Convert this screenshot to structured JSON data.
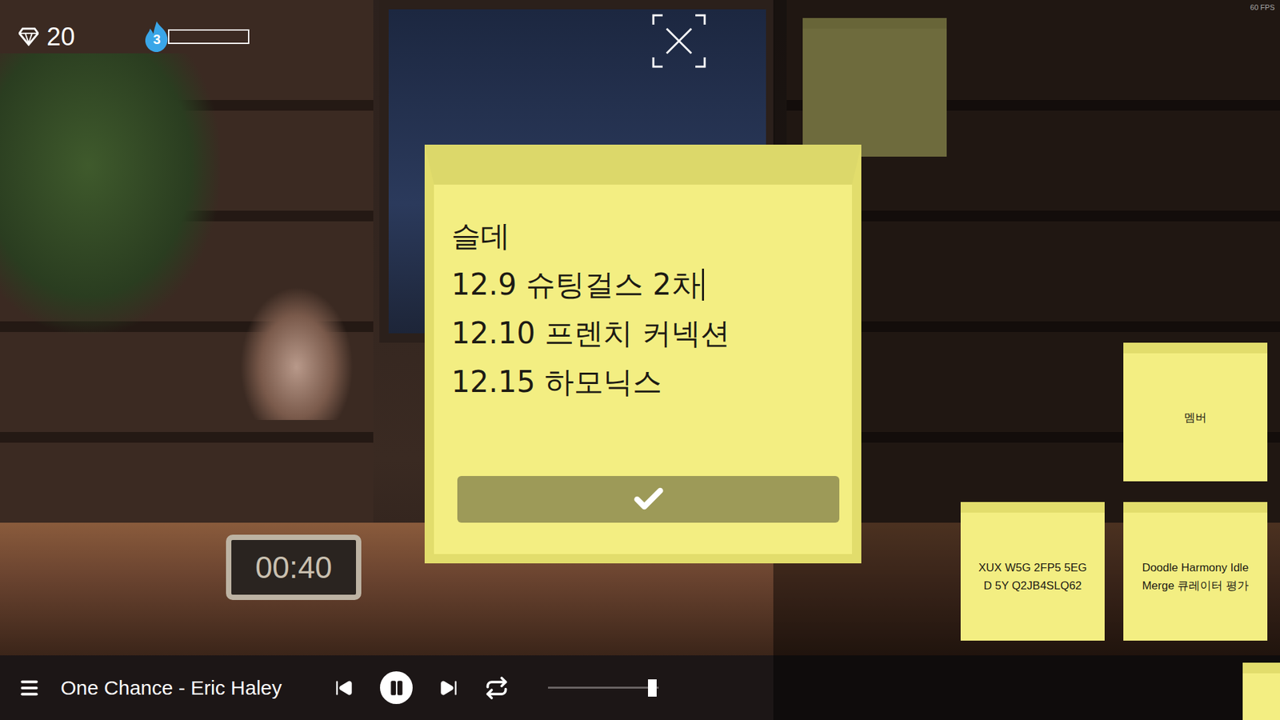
{
  "hud": {
    "gems": "20",
    "streak": "3",
    "streak_level": 0.0,
    "fps": "60 FPS"
  },
  "editor": {
    "lines": [
      {
        "text": "슬데",
        "caret": false
      },
      {
        "text": "12.9 슈팅걸스 2차",
        "caret": true
      },
      {
        "text": "12.10 프렌치 커넥션",
        "caret": false
      },
      {
        "text": "12.15 하모닉스",
        "caret": false
      }
    ]
  },
  "notes": [
    {
      "lines": [],
      "faded": true,
      "slot": "top"
    },
    {
      "lines": [
        "멤버"
      ],
      "faded": false,
      "slot": "right-upper"
    },
    {
      "lines": [
        "XUX W5G 2FP5 5EG",
        "D 5Y Q2JB4SLQ62"
      ],
      "faded": false,
      "slot": "middle-lower"
    },
    {
      "lines": [
        "Doodle Harmony Idle Merge 큐레이터 평가"
      ],
      "faded": false,
      "slot": "right-lower"
    },
    {
      "lines": [],
      "faded": false,
      "slot": "corner"
    }
  ],
  "clock": "00:40",
  "player": {
    "track": "One Chance - Eric Haley",
    "playing": true,
    "volume": 0.94
  }
}
